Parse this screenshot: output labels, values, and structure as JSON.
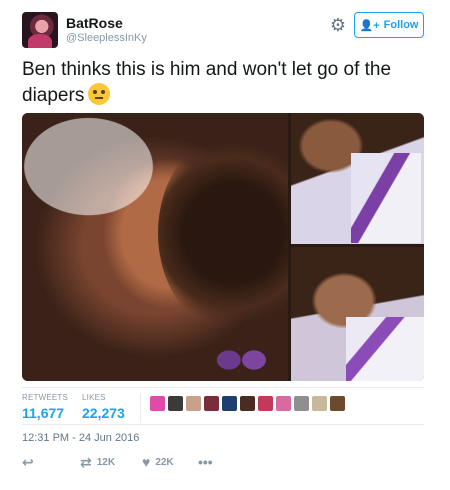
{
  "user": {
    "name": "BatRose",
    "handle": "@SleeplessInKy",
    "avatar_icon": "user-avatar"
  },
  "header": {
    "gear_icon": "gear-icon",
    "follow_label": "Follow",
    "follow_icon": "add-user-icon"
  },
  "tweet": {
    "text": "Ben thinks this is him and won't  let go of the diapers",
    "emoji": "face-with-rolling-eyes"
  },
  "media": {
    "photos": [
      "photo-1",
      "photo-2",
      "photo-3"
    ]
  },
  "stats": {
    "retweets_label": "RETWEETS",
    "retweets_value": "11,677",
    "likes_label": "LIKES",
    "likes_value": "22,273",
    "liker_colors": [
      "#e24aa8",
      "#3a3a3a",
      "#c9a08a",
      "#7a2c3a",
      "#1f3d6e",
      "#4a2c22",
      "#c23a5a",
      "#d86aa0",
      "#8f8f8f",
      "#c9b79a",
      "#6b4a30"
    ]
  },
  "timestamp": "12:31 PM - 24 Jun 2016",
  "actions": {
    "reply_icon": "reply-icon",
    "retweet_icon": "retweet-icon",
    "retweet_count": "12K",
    "like_icon": "heart-icon",
    "like_count": "22K",
    "more_icon": "more-icon"
  },
  "colors": {
    "accent": "#1da1f2",
    "muted": "#8899a6",
    "text": "#14171a"
  }
}
